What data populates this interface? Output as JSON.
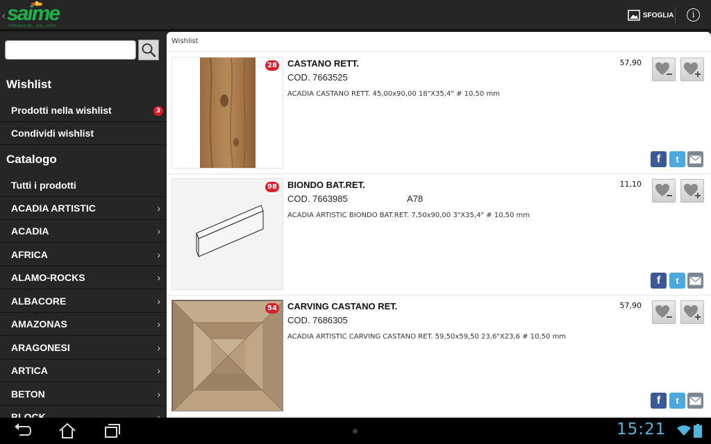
{
  "app": {
    "logo_text": "saime",
    "logo_subtitle": "CERAMICHE · DAL 1958",
    "sfoglia_label": "SFOGLIA",
    "info_glyph": "i",
    "back_glyph": "‹"
  },
  "search": {
    "value": "",
    "placeholder": ""
  },
  "sidebar": {
    "wishlist_title": "Wishlist",
    "wishlist_items": [
      {
        "label": "Prodotti nella wishlist",
        "badge": "3"
      },
      {
        "label": "Condividi wishlist"
      }
    ],
    "catalog_title": "Catalogo",
    "catalog_items": [
      {
        "label": "Tutti i prodotti"
      },
      {
        "label": "ACADIA ARTISTIC"
      },
      {
        "label": "ACADIA"
      },
      {
        "label": "AFRICA"
      },
      {
        "label": "ALAMO-ROCKS"
      },
      {
        "label": "ALBACORE"
      },
      {
        "label": "AMAZONAS"
      },
      {
        "label": "ARAGONESI"
      },
      {
        "label": "ARTICA"
      },
      {
        "label": "BETON"
      },
      {
        "label": "BLOCK"
      }
    ],
    "chevron_glyph": "›"
  },
  "content": {
    "title": "Wishlist",
    "products": [
      {
        "name": "CASTANO RETT.",
        "code": "COD. 7663525",
        "extra": "",
        "description": "ACADIA CASTANO RETT. 45,00x90,00 18\"X35,4\" # 10,50 mm",
        "price": "57,90",
        "qty": "28",
        "thumb": "wood-plank"
      },
      {
        "name": "BIONDO BAT.RET.",
        "code": "COD. 7663985",
        "extra": "A78",
        "description": "ACADIA ARTISTIC BIONDO BAT.RET. 7,50x90,00 3\"X35,4\" # 10,50 mm",
        "price": "11,10",
        "qty": "98",
        "thumb": "skirting-board"
      },
      {
        "name": "CARVING CASTANO RET.",
        "code": "COD. 7686305",
        "extra": "",
        "description": "ACADIA ARTISTIC CARVING CASTANO RET. 59,50x59,50 23,6\"X23,6 # 10,50 mm",
        "price": "57,90",
        "qty": "54",
        "thumb": "wood-parquet"
      }
    ],
    "social": {
      "facebook_glyph": "f",
      "twitter_glyph": "t"
    }
  },
  "status": {
    "time": "15:21"
  },
  "colors": {
    "accent": "#20b24a",
    "badge": "#d81e2a",
    "clock": "#4fb6e0",
    "facebook": "#3b5998",
    "twitter": "#4aa9e0"
  }
}
